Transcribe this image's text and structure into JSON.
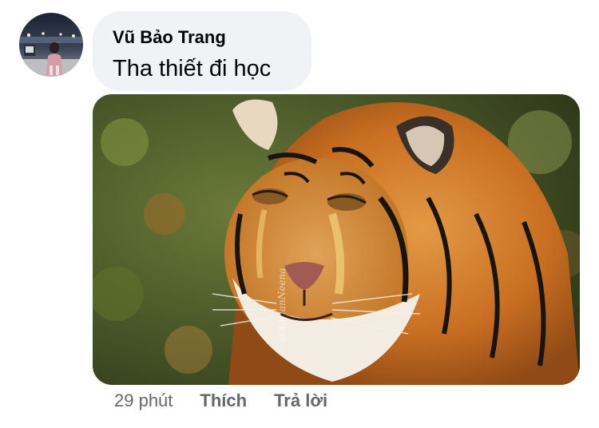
{
  "comment": {
    "author_name": "Vũ Bảo Trang",
    "text": "Tha thiết đi học",
    "attachment": {
      "kind": "photo",
      "subject": "tiger-with-tearful-face-meme",
      "watermark": "@AdrianNeena"
    }
  },
  "actions": {
    "timestamp": "29 phút",
    "like_label": "Thích",
    "reply_label": "Trả lời"
  },
  "colors": {
    "bubble_background": "#f0f2f5",
    "author_text": "#050505",
    "meta_text": "#65676b"
  }
}
